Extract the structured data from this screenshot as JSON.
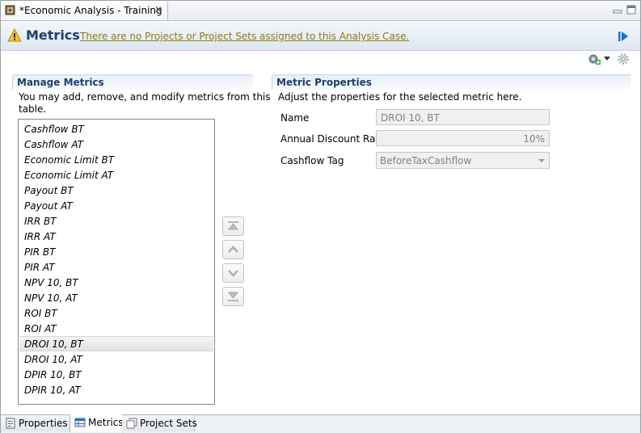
{
  "editor_tab": {
    "title": "*Economic Analysis - Training"
  },
  "header": {
    "title": "Metrics",
    "warning_link": "There are no Projects or Project Sets assigned to this Analysis Case."
  },
  "manage": {
    "title": "Manage Metrics",
    "description_line1": "You may add, remove, and modify metrics from this",
    "description_line2": "table.",
    "metrics": [
      "Cashflow BT",
      "Cashflow AT",
      "Economic Limit BT",
      "Economic Limit AT",
      "Payout BT",
      "Payout AT",
      "IRR BT",
      "IRR AT",
      "PIR BT",
      "PIR AT",
      "NPV 10, BT",
      "NPV 10, AT",
      "ROI BT",
      "ROI AT",
      "DROI 10, BT",
      "DROI 10, AT",
      "DPIR 10, BT",
      "DPIR 10, AT"
    ],
    "selected_index": 14
  },
  "properties": {
    "title": "Metric Properties",
    "description": "Adjust the properties for the selected metric here.",
    "name_label": "Name",
    "name_value": "DROI 10, BT",
    "rate_label": "Annual Discount Rate",
    "rate_value": "10%",
    "tag_label": "Cashflow Tag",
    "tag_value": "BeforeTaxCashflow"
  },
  "bottom_tabs": [
    {
      "label": "Properties",
      "icon": "properties-icon",
      "active": false
    },
    {
      "label": "Metrics",
      "icon": "metrics-icon",
      "active": true
    },
    {
      "label": "Project Sets",
      "icon": "project-sets-icon",
      "active": false
    }
  ],
  "colors": {
    "header_title": "#1f3e6d",
    "warning_link": "#8a7e10",
    "run_blue": "#1a6fd6"
  }
}
